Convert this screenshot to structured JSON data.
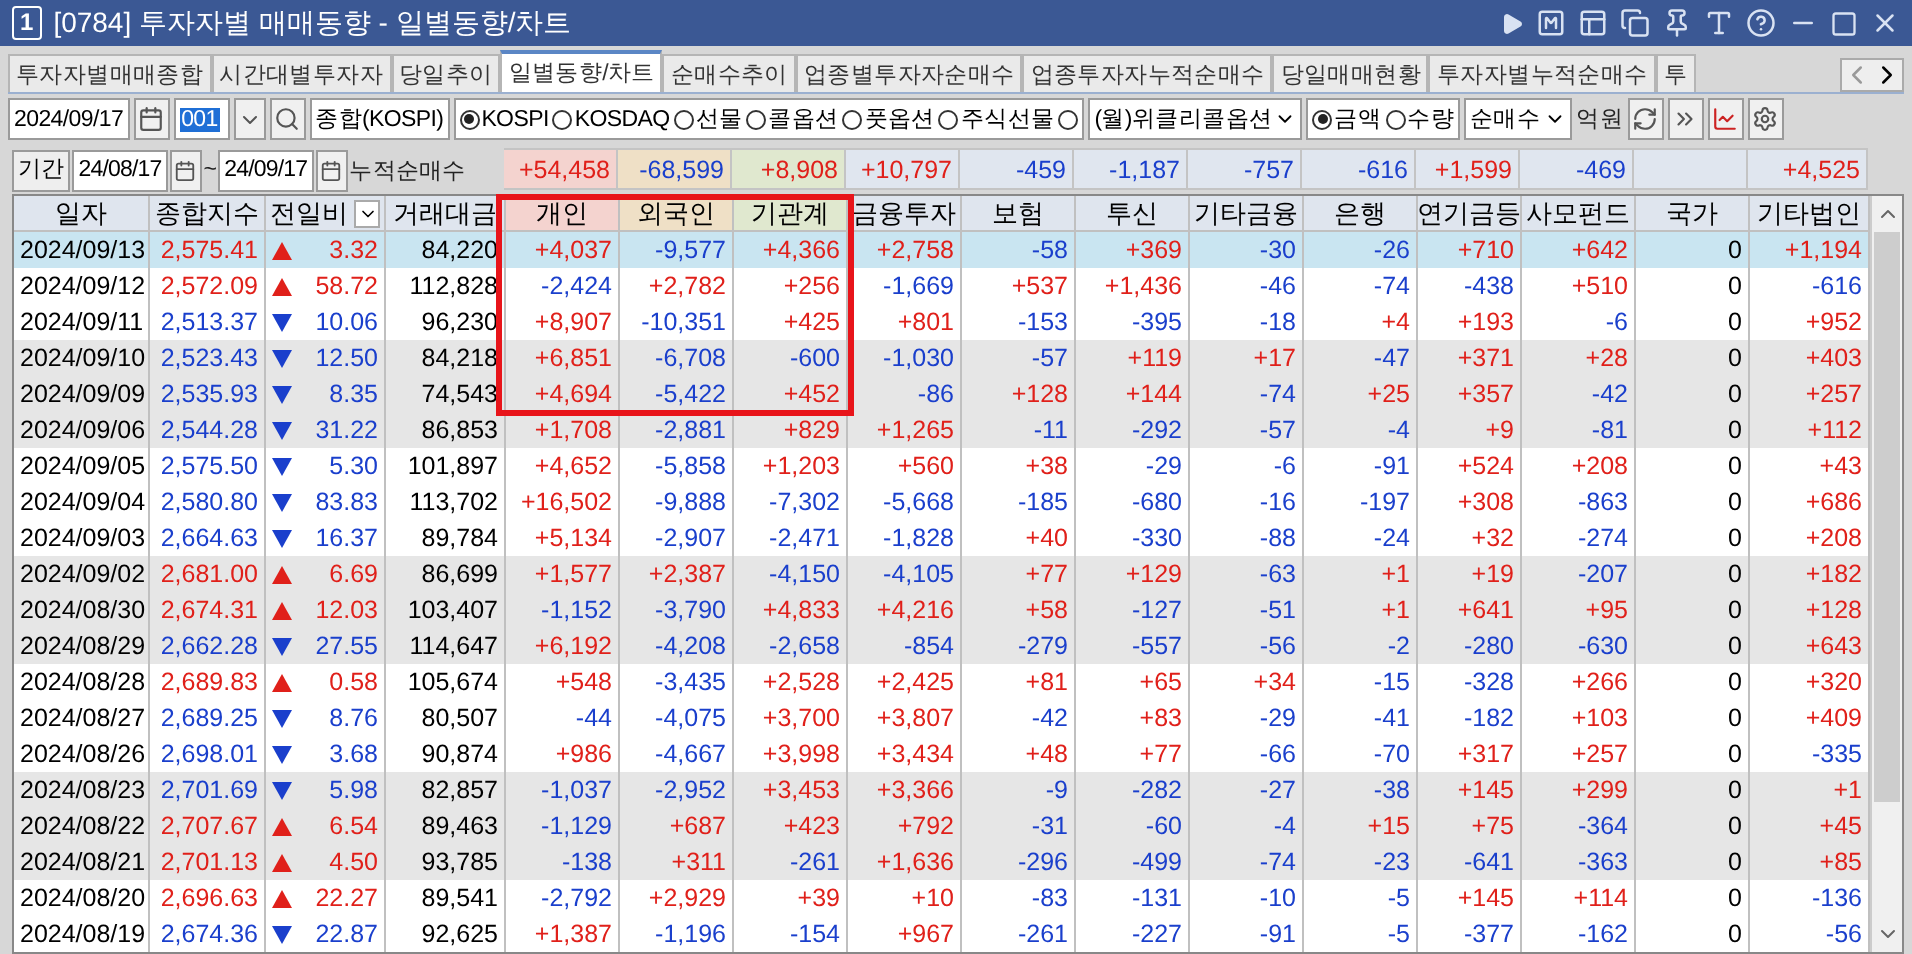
{
  "window": {
    "badge": "1",
    "title": "[0784] 투자자별 매매동향 - 일별동향/차트"
  },
  "tabs": [
    {
      "label": "투자자별매매종합",
      "selected": false
    },
    {
      "label": "시간대별투자자",
      "selected": false
    },
    {
      "label": "당일추이",
      "selected": false
    },
    {
      "label": "일별동향/차트",
      "selected": true
    },
    {
      "label": "순매수추이",
      "selected": false
    },
    {
      "label": "업종별투자자순매수",
      "selected": false
    },
    {
      "label": "업종투자자누적순매수",
      "selected": false
    },
    {
      "label": "당일매매현황",
      "selected": false
    },
    {
      "label": "투자자별누적순매수",
      "selected": false
    },
    {
      "label": "투",
      "selected": false
    }
  ],
  "toolbar": {
    "date": "2024/09/17",
    "code": {
      "value": "001",
      "highlighted": true
    },
    "market_name": "종합(KOSPI)",
    "markets": [
      {
        "label": "KOSPI",
        "selected": true
      },
      {
        "label": "KOSDAQ",
        "selected": false
      },
      {
        "label": "선물",
        "selected": false
      },
      {
        "label": "콜옵션",
        "selected": false
      },
      {
        "label": "풋옵션",
        "selected": false
      },
      {
        "label": "주식선물",
        "selected": false
      }
    ],
    "weekly_option": {
      "selected": false,
      "value": "(월)위클리콜옵션"
    },
    "units": [
      {
        "label": "금액",
        "selected": true
      },
      {
        "label": "수량",
        "selected": false
      }
    ],
    "mode": "순매수",
    "unit_label": "억원"
  },
  "cumulative": {
    "period_label": "기간",
    "from": "24/08/17",
    "separator": "~",
    "to": "24/09/17",
    "label": "누적순매수",
    "values": [
      {
        "value": "+54,458"
      },
      {
        "value": "-68,599"
      },
      {
        "value": "+8,908"
      },
      {
        "value": "+10,797"
      },
      {
        "value": "-459"
      },
      {
        "value": "-1,187"
      },
      {
        "value": "-757"
      },
      {
        "value": "-616"
      },
      {
        "value": "+1,599"
      },
      {
        "value": "-469"
      },
      {
        "blank": true
      },
      {
        "value": "+4,525"
      }
    ]
  },
  "table": {
    "columns": [
      {
        "label": "일자"
      },
      {
        "label": "종합지수"
      },
      {
        "label": "전일비",
        "dropdown": true
      },
      {
        "label": "거래대금"
      },
      {
        "label": "개인",
        "color": "#f4d3cf",
        "boxed": true
      },
      {
        "label": "외국인",
        "color": "#efe0c6",
        "boxed": true
      },
      {
        "label": "기관계",
        "color": "#e0e8cf",
        "boxed": true
      },
      {
        "label": "금융투자"
      },
      {
        "label": "보험"
      },
      {
        "label": "투신"
      },
      {
        "label": "기타금융"
      },
      {
        "label": "은행"
      },
      {
        "label": "연기금등"
      },
      {
        "label": "사모펀드"
      },
      {
        "label": "국가"
      },
      {
        "label": "기타법인"
      }
    ],
    "rows": [
      {
        "date": "2024/09/13",
        "index": "2,575.41",
        "rising": true,
        "change": "3.32",
        "volume": "84,220",
        "values": [
          "+4,037",
          "-9,577",
          "+4,366",
          "+2,758",
          "-58",
          "+369",
          "-30",
          "-26",
          "+710",
          "+642",
          "0",
          "+1,194"
        ],
        "selected": true,
        "shaded": false,
        "boxed": true
      },
      {
        "date": "2024/09/12",
        "index": "2,572.09",
        "rising": true,
        "change": "58.72",
        "volume": "112,828",
        "values": [
          "-2,424",
          "+2,782",
          "+256",
          "-1,669",
          "+537",
          "+1,436",
          "-46",
          "-74",
          "-438",
          "+510",
          "0",
          "-616"
        ],
        "selected": false,
        "shaded": false,
        "boxed": true
      },
      {
        "date": "2024/09/11",
        "index": "2,513.37",
        "rising": false,
        "change": "10.06",
        "volume": "96,230",
        "values": [
          "+8,907",
          "-10,351",
          "+425",
          "+801",
          "-153",
          "-395",
          "-18",
          "+4",
          "+193",
          "-6",
          "0",
          "+952"
        ],
        "selected": false,
        "shaded": false,
        "boxed": true
      },
      {
        "date": "2024/09/10",
        "index": "2,523.43",
        "rising": false,
        "change": "12.50",
        "volume": "84,218",
        "values": [
          "+6,851",
          "-6,708",
          "-600",
          "-1,030",
          "-57",
          "+119",
          "+17",
          "-47",
          "+371",
          "+28",
          "0",
          "+403"
        ],
        "selected": false,
        "shaded": true,
        "boxed": true
      },
      {
        "date": "2024/09/09",
        "index": "2,535.93",
        "rising": false,
        "change": "8.35",
        "volume": "74,543",
        "values": [
          "+4,694",
          "-5,422",
          "+452",
          "-86",
          "+128",
          "+144",
          "-74",
          "+25",
          "+357",
          "-42",
          "0",
          "+257"
        ],
        "selected": false,
        "shaded": true,
        "boxed": true
      },
      {
        "date": "2024/09/06",
        "index": "2,544.28",
        "rising": false,
        "change": "31.22",
        "volume": "86,853",
        "values": [
          "+1,708",
          "-2,881",
          "+829",
          "+1,265",
          "-11",
          "-292",
          "-57",
          "-4",
          "+9",
          "-81",
          "0",
          "+112"
        ],
        "selected": false,
        "shaded": true,
        "boxed": false
      },
      {
        "date": "2024/09/05",
        "index": "2,575.50",
        "rising": false,
        "change": "5.30",
        "volume": "101,897",
        "values": [
          "+4,652",
          "-5,858",
          "+1,203",
          "+560",
          "+38",
          "-29",
          "-6",
          "-91",
          "+524",
          "+208",
          "0",
          "+43"
        ],
        "selected": false,
        "shaded": false,
        "boxed": false
      },
      {
        "date": "2024/09/04",
        "index": "2,580.80",
        "rising": false,
        "change": "83.83",
        "volume": "113,702",
        "values": [
          "+16,502",
          "-9,888",
          "-7,302",
          "-5,668",
          "-185",
          "-680",
          "-16",
          "-197",
          "+308",
          "-863",
          "0",
          "+686"
        ],
        "selected": false,
        "shaded": false,
        "boxed": false
      },
      {
        "date": "2024/09/03",
        "index": "2,664.63",
        "rising": false,
        "change": "16.37",
        "volume": "89,784",
        "values": [
          "+5,134",
          "-2,907",
          "-2,471",
          "-1,828",
          "+40",
          "-330",
          "-88",
          "-24",
          "+32",
          "-274",
          "0",
          "+208"
        ],
        "selected": false,
        "shaded": false,
        "boxed": false
      },
      {
        "date": "2024/09/02",
        "index": "2,681.00",
        "rising": true,
        "change": "6.69",
        "volume": "86,699",
        "values": [
          "+1,577",
          "+2,387",
          "-4,150",
          "-4,105",
          "+77",
          "+129",
          "-63",
          "+1",
          "+19",
          "-207",
          "0",
          "+182"
        ],
        "selected": false,
        "shaded": true,
        "boxed": false
      },
      {
        "date": "2024/08/30",
        "index": "2,674.31",
        "rising": true,
        "change": "12.03",
        "volume": "103,407",
        "values": [
          "-1,152",
          "-3,790",
          "+4,833",
          "+4,216",
          "+58",
          "-127",
          "-51",
          "+1",
          "+641",
          "+95",
          "0",
          "+128"
        ],
        "selected": false,
        "shaded": true,
        "boxed": false
      },
      {
        "date": "2024/08/29",
        "index": "2,662.28",
        "rising": false,
        "change": "27.55",
        "volume": "114,647",
        "values": [
          "+6,192",
          "-4,208",
          "-2,658",
          "-854",
          "-279",
          "-557",
          "-56",
          "-2",
          "-280",
          "-630",
          "0",
          "+643"
        ],
        "selected": false,
        "shaded": true,
        "boxed": false
      },
      {
        "date": "2024/08/28",
        "index": "2,689.83",
        "rising": true,
        "change": "0.58",
        "volume": "105,674",
        "values": [
          "+548",
          "-3,435",
          "+2,528",
          "+2,425",
          "+81",
          "+65",
          "+34",
          "-15",
          "-328",
          "+266",
          "0",
          "+320"
        ],
        "selected": false,
        "shaded": false,
        "boxed": false
      },
      {
        "date": "2024/08/27",
        "index": "2,689.25",
        "rising": false,
        "change": "8.76",
        "volume": "80,507",
        "values": [
          "-44",
          "-4,075",
          "+3,700",
          "+3,807",
          "-42",
          "+83",
          "-29",
          "-41",
          "-182",
          "+103",
          "0",
          "+409"
        ],
        "selected": false,
        "shaded": false,
        "boxed": false
      },
      {
        "date": "2024/08/26",
        "index": "2,698.01",
        "rising": false,
        "change": "3.68",
        "volume": "90,874",
        "values": [
          "+986",
          "-4,667",
          "+3,998",
          "+3,434",
          "+48",
          "+77",
          "-66",
          "-70",
          "+317",
          "+257",
          "0",
          "-335"
        ],
        "selected": false,
        "shaded": false,
        "boxed": false
      },
      {
        "date": "2024/08/23",
        "index": "2,701.69",
        "rising": false,
        "change": "5.98",
        "volume": "82,857",
        "values": [
          "-1,037",
          "-2,952",
          "+3,453",
          "+3,366",
          "-9",
          "-282",
          "-27",
          "-38",
          "+145",
          "+299",
          "0",
          "+1"
        ],
        "selected": false,
        "shaded": true,
        "boxed": false
      },
      {
        "date": "2024/08/22",
        "index": "2,707.67",
        "rising": true,
        "change": "6.54",
        "volume": "89,463",
        "values": [
          "-1,129",
          "+687",
          "+423",
          "+792",
          "-31",
          "-60",
          "-4",
          "+15",
          "+75",
          "-364",
          "0",
          "+45"
        ],
        "selected": false,
        "shaded": true,
        "boxed": false
      },
      {
        "date": "2024/08/21",
        "index": "2,701.13",
        "rising": true,
        "change": "4.50",
        "volume": "93,785",
        "values": [
          "-138",
          "+311",
          "-261",
          "+1,636",
          "-296",
          "-499",
          "-74",
          "-23",
          "-641",
          "-363",
          "0",
          "+85"
        ],
        "selected": false,
        "shaded": true,
        "boxed": false
      },
      {
        "date": "2024/08/20",
        "index": "2,696.63",
        "rising": true,
        "change": "22.27",
        "volume": "89,541",
        "values": [
          "-2,792",
          "+2,929",
          "+39",
          "+10",
          "-83",
          "-131",
          "-10",
          "-5",
          "+145",
          "+114",
          "0",
          "-136"
        ],
        "selected": false,
        "shaded": false,
        "boxed": false
      },
      {
        "date": "2024/08/19",
        "index": "2,674.36",
        "rising": false,
        "change": "22.87",
        "volume": "92,625",
        "values": [
          "+1,387",
          "-1,196",
          "-154",
          "+967",
          "-261",
          "-227",
          "-91",
          "-5",
          "-377",
          "-162",
          "0",
          "-56"
        ],
        "selected": false,
        "shaded": false,
        "boxed": false
      }
    ]
  }
}
